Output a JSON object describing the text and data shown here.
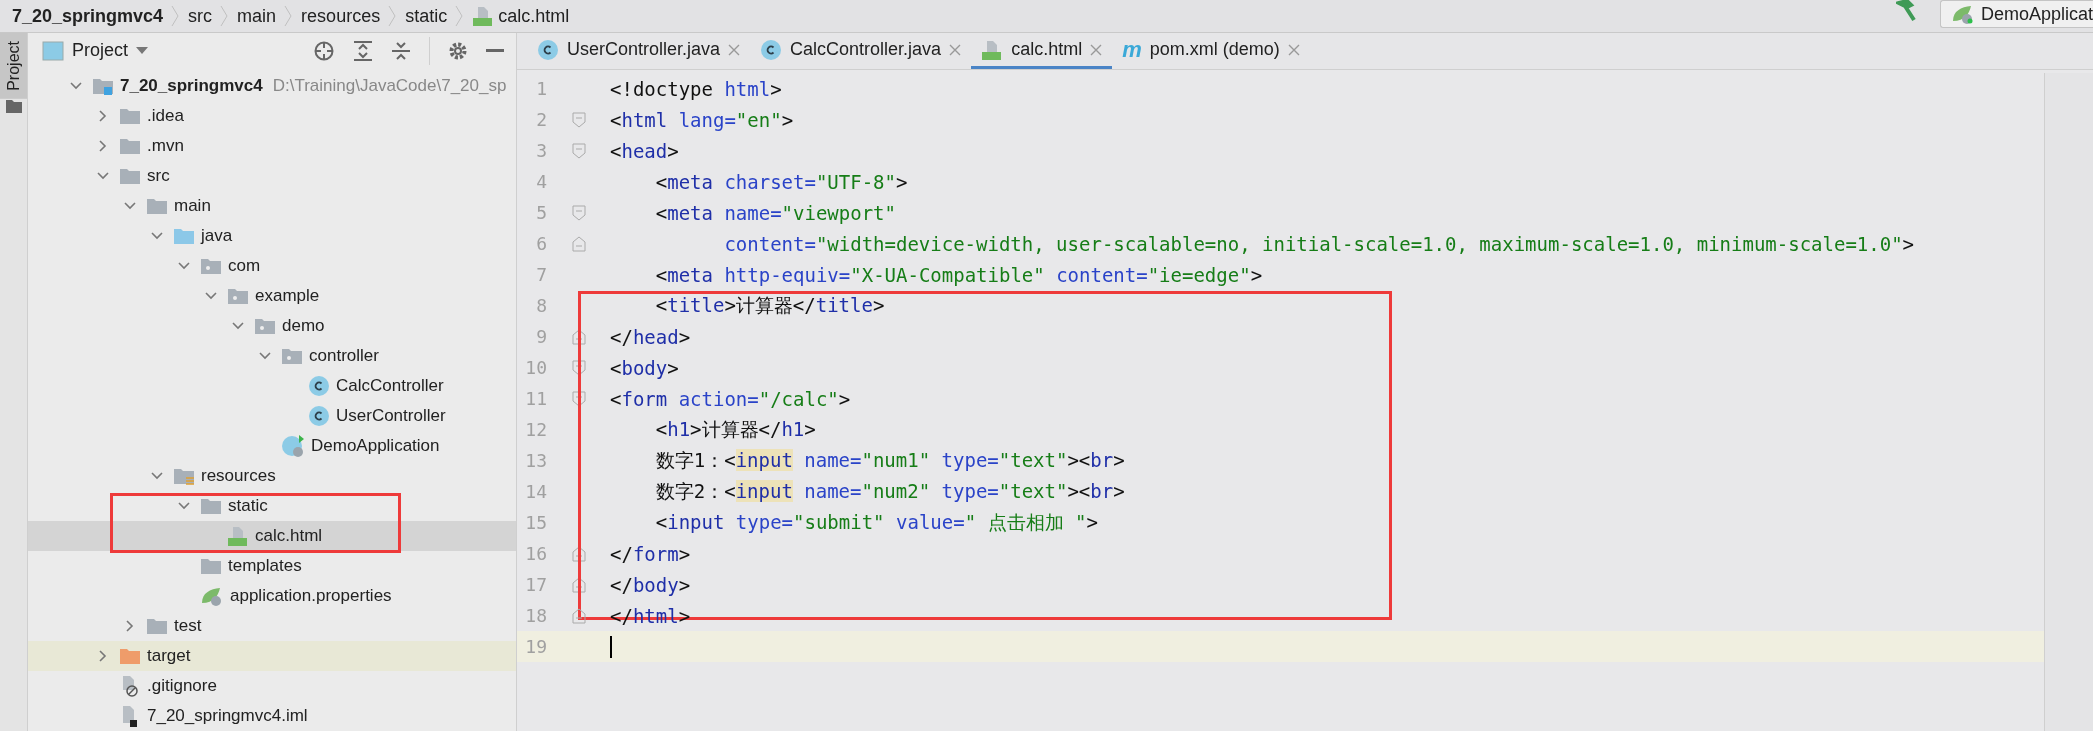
{
  "breadcrumb": [
    {
      "label": "7_20_springmvc4",
      "kind": "project"
    },
    {
      "label": "src",
      "kind": "folder"
    },
    {
      "label": "main",
      "kind": "folder"
    },
    {
      "label": "resources",
      "kind": "folder"
    },
    {
      "label": "static",
      "kind": "folder"
    },
    {
      "label": "calc.html",
      "kind": "html"
    }
  ],
  "run_config": {
    "label": "DemoApplicat"
  },
  "side_tab": {
    "label": "Project",
    "selected": true
  },
  "project_panel": {
    "title": "Project",
    "tree": [
      {
        "label": "7_20_springmvc4",
        "path": "D:\\Training\\JavaCode\\7_20_sp",
        "kind": "project-folder",
        "expanded": true,
        "selected": false,
        "children": [
          {
            "label": ".idea",
            "kind": "folder",
            "expanded": false,
            "selected": false
          },
          {
            "label": ".mvn",
            "kind": "folder",
            "expanded": false,
            "selected": false
          },
          {
            "label": "src",
            "kind": "folder",
            "expanded": true,
            "selected": false,
            "children": [
              {
                "label": "main",
                "kind": "folder",
                "expanded": true,
                "selected": false,
                "children": [
                  {
                    "label": "java",
                    "kind": "source-folder",
                    "expanded": true,
                    "selected": false,
                    "children": [
                      {
                        "label": "com",
                        "kind": "package",
                        "expanded": true,
                        "selected": false,
                        "children": [
                          {
                            "label": "example",
                            "kind": "package",
                            "expanded": true,
                            "selected": false,
                            "children": [
                              {
                                "label": "demo",
                                "kind": "package",
                                "expanded": true,
                                "selected": false,
                                "children": [
                                  {
                                    "label": "controller",
                                    "kind": "package",
                                    "expanded": true,
                                    "selected": false,
                                    "children": [
                                      {
                                        "label": "CalcController",
                                        "kind": "class",
                                        "selected": false
                                      },
                                      {
                                        "label": "UserController",
                                        "kind": "class",
                                        "selected": false
                                      }
                                    ]
                                  },
                                  {
                                    "label": "DemoApplication",
                                    "kind": "spring-class",
                                    "selected": false
                                  }
                                ]
                              }
                            ]
                          }
                        ]
                      }
                    ]
                  },
                  {
                    "label": "resources",
                    "kind": "resources-folder",
                    "expanded": true,
                    "selected": false,
                    "children": [
                      {
                        "label": "static",
                        "kind": "folder",
                        "expanded": true,
                        "selected": false,
                        "boxed": true,
                        "children": [
                          {
                            "label": "calc.html",
                            "kind": "html",
                            "selected": true
                          }
                        ]
                      },
                      {
                        "label": "templates",
                        "kind": "folder",
                        "selected": false
                      },
                      {
                        "label": "application.properties",
                        "kind": "properties",
                        "selected": false
                      }
                    ]
                  }
                ]
              },
              {
                "label": "test",
                "kind": "folder",
                "expanded": false,
                "selected": false
              }
            ]
          },
          {
            "label": "target",
            "kind": "excluded-folder",
            "expanded": false,
            "selected": false
          },
          {
            "label": ".gitignore",
            "kind": "ignore-file",
            "selected": false
          },
          {
            "label": "7_20_springmvc4.iml",
            "kind": "module-file",
            "selected": false
          }
        ]
      }
    ]
  },
  "editor_tabs": [
    {
      "label": "UserController.java",
      "kind": "class",
      "selected": false
    },
    {
      "label": "CalcController.java",
      "kind": "class",
      "selected": false
    },
    {
      "label": "calc.html",
      "kind": "html",
      "selected": true
    },
    {
      "label": "pom.xml (demo)",
      "kind": "maven",
      "glyph": "m",
      "selected": false
    }
  ],
  "code_blocks": [
    {
      "lines": [
        {
          "number": "1",
          "kind": "plain",
          "current": false,
          "tokens": [
            {
              "kind": "punct",
              "text": "<!doctype "
            },
            {
              "kind": "attr",
              "text": "html"
            },
            {
              "kind": "punct",
              "text": ">"
            }
          ]
        },
        {
          "number": "2",
          "kind": "fold-start",
          "current": false,
          "tokens": [
            {
              "kind": "punct",
              "text": "<"
            },
            {
              "kind": "tag",
              "text": "html "
            },
            {
              "kind": "attr",
              "text": "lang="
            },
            {
              "kind": "string",
              "text": "\"en\""
            },
            {
              "kind": "punct",
              "text": ">"
            }
          ]
        },
        {
          "number": "3",
          "kind": "fold-start",
          "current": false,
          "tokens": [
            {
              "kind": "punct",
              "text": "<"
            },
            {
              "kind": "tag",
              "text": "head"
            },
            {
              "kind": "punct",
              "text": ">"
            }
          ]
        },
        {
          "number": "4",
          "kind": "plain",
          "current": false,
          "tokens": [
            {
              "kind": "punct",
              "text": "    <"
            },
            {
              "kind": "tag",
              "text": "meta "
            },
            {
              "kind": "attr",
              "text": "charset="
            },
            {
              "kind": "string",
              "text": "\"UTF-8\""
            },
            {
              "kind": "punct",
              "text": ">"
            }
          ]
        },
        {
          "number": "5",
          "kind": "fold-start",
          "current": false,
          "tokens": [
            {
              "kind": "punct",
              "text": "    <"
            },
            {
              "kind": "tag",
              "text": "meta "
            },
            {
              "kind": "attr",
              "text": "name="
            },
            {
              "kind": "string",
              "text": "\"viewport\""
            }
          ]
        },
        {
          "number": "6",
          "kind": "fold-end",
          "current": false,
          "tokens": [
            {
              "kind": "attr",
              "text": "          content="
            },
            {
              "kind": "string",
              "text": "\"width=device-width, user-scalable=no, initial-scale=1.0, maximum-scale=1.0, minimum-scale=1.0\""
            },
            {
              "kind": "punct",
              "text": ">"
            }
          ]
        },
        {
          "number": "7",
          "kind": "plain",
          "current": false,
          "tokens": [
            {
              "kind": "punct",
              "text": "    <"
            },
            {
              "kind": "tag",
              "text": "meta "
            },
            {
              "kind": "attr",
              "text": "http-equiv="
            },
            {
              "kind": "string",
              "text": "\"X-UA-Compatible\" "
            },
            {
              "kind": "attr",
              "text": "content="
            },
            {
              "kind": "string",
              "text": "\"ie=edge\""
            },
            {
              "kind": "punct",
              "text": ">"
            }
          ]
        }
      ]
    },
    {
      "boxed": true,
      "lines": [
        {
          "number": "8",
          "kind": "plain",
          "current": false,
          "tokens": [
            {
              "kind": "punct",
              "text": "    <"
            },
            {
              "kind": "tag",
              "text": "title"
            },
            {
              "kind": "punct",
              "text": ">计算器</"
            },
            {
              "kind": "tag",
              "text": "title"
            },
            {
              "kind": "punct",
              "text": ">"
            }
          ]
        },
        {
          "number": "9",
          "kind": "fold-end",
          "current": false,
          "tokens": [
            {
              "kind": "punct",
              "text": "</"
            },
            {
              "kind": "tag",
              "text": "head"
            },
            {
              "kind": "punct",
              "text": ">"
            }
          ]
        },
        {
          "number": "10",
          "kind": "fold-start",
          "current": false,
          "tokens": [
            {
              "kind": "punct",
              "text": "<"
            },
            {
              "kind": "tag",
              "text": "body"
            },
            {
              "kind": "punct",
              "text": ">"
            }
          ]
        },
        {
          "number": "11",
          "kind": "fold-start",
          "current": false,
          "tokens": [
            {
              "kind": "punct",
              "text": "<"
            },
            {
              "kind": "tag",
              "text": "form "
            },
            {
              "kind": "attr",
              "text": "action="
            },
            {
              "kind": "string",
              "text": "\"/calc\""
            },
            {
              "kind": "punct",
              "text": ">"
            }
          ]
        },
        {
          "number": "12",
          "kind": "plain",
          "current": false,
          "tokens": [
            {
              "kind": "punct",
              "text": "    <"
            },
            {
              "kind": "tag",
              "text": "h1"
            },
            {
              "kind": "punct",
              "text": ">计算器</"
            },
            {
              "kind": "tag",
              "text": "h1"
            },
            {
              "kind": "punct",
              "text": ">"
            }
          ]
        },
        {
          "number": "13",
          "kind": "plain",
          "current": false,
          "tokens": [
            {
              "kind": "punct",
              "text": "    数字1：<"
            },
            {
              "kind": "tag-marked",
              "text": "input"
            },
            {
              "kind": "attr",
              "text": " name="
            },
            {
              "kind": "string",
              "text": "\"num1\" "
            },
            {
              "kind": "attr",
              "text": "type="
            },
            {
              "kind": "string",
              "text": "\"text\""
            },
            {
              "kind": "punct",
              "text": "><"
            },
            {
              "kind": "tag",
              "text": "br"
            },
            {
              "kind": "punct",
              "text": ">"
            }
          ]
        },
        {
          "number": "14",
          "kind": "plain",
          "current": false,
          "tokens": [
            {
              "kind": "punct",
              "text": "    数字2：<"
            },
            {
              "kind": "tag-marked",
              "text": "input"
            },
            {
              "kind": "attr",
              "text": " name="
            },
            {
              "kind": "string",
              "text": "\"num2\" "
            },
            {
              "kind": "attr",
              "text": "type="
            },
            {
              "kind": "string",
              "text": "\"text\""
            },
            {
              "kind": "punct",
              "text": "><"
            },
            {
              "kind": "tag",
              "text": "br"
            },
            {
              "kind": "punct",
              "text": ">"
            }
          ]
        },
        {
          "number": "15",
          "kind": "plain",
          "current": false,
          "tokens": [
            {
              "kind": "punct",
              "text": "    <"
            },
            {
              "kind": "tag",
              "text": "input "
            },
            {
              "kind": "attr",
              "text": "type="
            },
            {
              "kind": "string",
              "text": "\"submit\" "
            },
            {
              "kind": "attr",
              "text": "value="
            },
            {
              "kind": "string",
              "text": "\" 点击相加 \""
            },
            {
              "kind": "punct",
              "text": ">"
            }
          ]
        },
        {
          "number": "16",
          "kind": "fold-end",
          "current": false,
          "tokens": [
            {
              "kind": "punct",
              "text": "</"
            },
            {
              "kind": "tag",
              "text": "form"
            },
            {
              "kind": "punct",
              "text": ">"
            }
          ]
        },
        {
          "number": "17",
          "kind": "fold-end",
          "current": false,
          "tokens": [
            {
              "kind": "punct",
              "text": "</"
            },
            {
              "kind": "tag",
              "text": "body"
            },
            {
              "kind": "punct",
              "text": ">"
            }
          ]
        }
      ]
    },
    {
      "lines": [
        {
          "number": "18",
          "kind": "fold-end",
          "current": false,
          "tokens": [
            {
              "kind": "punct",
              "text": "</"
            },
            {
              "kind": "tag",
              "text": "html"
            },
            {
              "kind": "punct",
              "text": ">"
            }
          ]
        },
        {
          "number": "19",
          "kind": "plain",
          "current": true
        }
      ]
    }
  ]
}
